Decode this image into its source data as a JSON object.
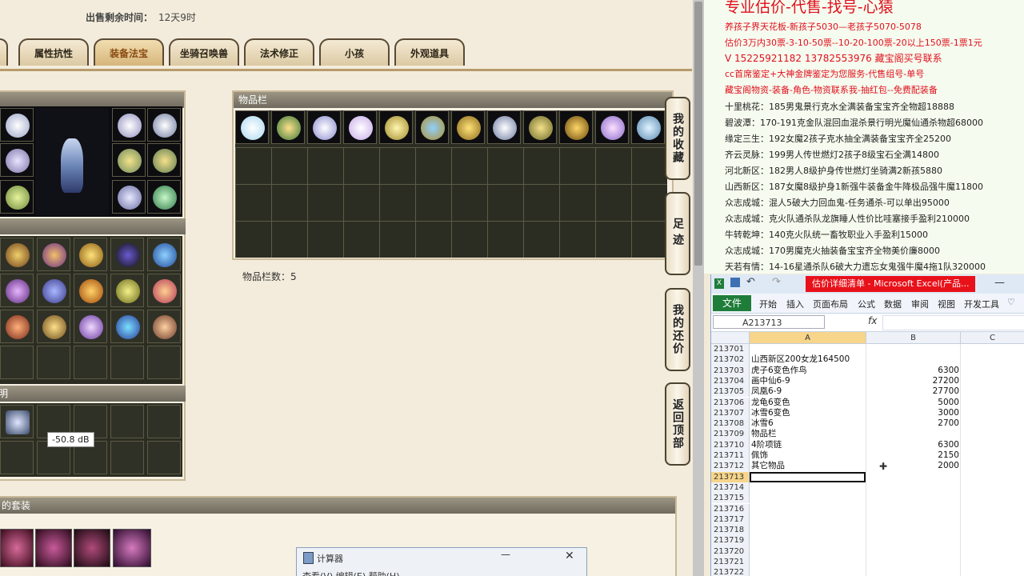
{
  "game": {
    "sell_label": "出售剩余时间：",
    "sell_value": "12天9时",
    "tabs": [
      {
        "label": "属性抗性",
        "active": false
      },
      {
        "label": "装备法宝",
        "active": true
      },
      {
        "label": "坐骑召唤兽",
        "active": false
      },
      {
        "label": "法术修正",
        "active": false
      },
      {
        "label": "小孩",
        "active": false
      },
      {
        "label": "外观道具",
        "active": false
      }
    ],
    "inventory_title": "物品栏",
    "inventory_count_label": "物品栏数：5",
    "partial_title_1": "明",
    "partial_title_2": "的套装",
    "side_buttons": [
      {
        "label": "我的收藏"
      },
      {
        "label": "足迹"
      },
      {
        "label": "我的还价"
      },
      {
        "label": "返回顶部"
      }
    ],
    "tooltip": "-50.8 dB"
  },
  "calculator": {
    "title": "计算器",
    "menu": "查看(V)  编辑(E)  帮助(H)"
  },
  "textdoc": {
    "lines": [
      {
        "text": "专业估价-代售-找号-心猿",
        "style": "big"
      },
      {
        "text": "养孩子界天花板-新孩子5030—老孩子5070-5078",
        "style": "red"
      },
      {
        "text": "估价3万内30票-3-10-50票--10-20-100票-20以上150票-1票1元",
        "style": "red"
      },
      {
        "text": "V 15225921182    13782553976    藏宝阁买号联系",
        "style": "red"
      },
      {
        "text": "cc首席鉴定+大神金牌鉴定为您服务-代售组号-单号",
        "style": "red"
      },
      {
        "text": "藏宝阁物资-装备-角色-物资联系我-抽红包--免费配装备",
        "style": "red"
      },
      {
        "text": "十里桃花：185男鬼景行克水全满装备宝宝齐全物超18888",
        "style": "normal"
      },
      {
        "text": "碧波潭：170-191克金队混回血混杀景行明光魔仙通杀物超68000",
        "style": "normal"
      },
      {
        "text": "缘定三生：192女魔2孩子克水抽全满装备宝宝齐全25200",
        "style": "normal"
      },
      {
        "text": "齐云灵脉：199男人传世燃灯2孩子8级宝石全满14800",
        "style": "normal"
      },
      {
        "text": "河北新区：182男人8级护身传世燃灯坐骑满2新孩5880",
        "style": "normal"
      },
      {
        "text": "山西新区：187女魔8级护身1新强牛装备金牛降极品强牛魔11800",
        "style": "normal"
      },
      {
        "text": "众志成城：混人5破大力回血鬼-任务通杀-可以单出95000",
        "style": "normal"
      },
      {
        "text": "众志成城：克火队通杀队龙旗睡人性价比哇塞接手盈利210000",
        "style": "normal"
      },
      {
        "text": "牛转乾坤：140克火队统一畜牧职业入手盈利15000",
        "style": "normal"
      },
      {
        "text": "众志成城：170男魔克火抽装备宝宝齐全物美价廉8000",
        "style": "normal"
      },
      {
        "text": "天若有情：14-16星通杀队6破大力遗忘女鬼强牛魔4拖1队320000",
        "style": "normal"
      }
    ]
  },
  "excel": {
    "title": "估价详细清单 - Microsoft Excel(产品...",
    "file_tab": "文件",
    "menus": [
      "开始",
      "插入",
      "页面布局",
      "公式",
      "数据",
      "审阅",
      "视图",
      "开发工具"
    ],
    "namebox": "A213713",
    "fx": "fx",
    "columns": [
      "A",
      "B",
      "C"
    ],
    "rows": [
      {
        "num": "213701",
        "a": "",
        "b": ""
      },
      {
        "num": "213702",
        "a": "山西新区200女龙164500",
        "b": ""
      },
      {
        "num": "213703",
        "a": "虎子6变色作鸟",
        "b": "6300"
      },
      {
        "num": "213704",
        "a": "画中仙6-9",
        "b": "27200"
      },
      {
        "num": "213705",
        "a": "凤凰6-9",
        "b": "27700"
      },
      {
        "num": "213706",
        "a": "龙龟6变色",
        "b": "5000"
      },
      {
        "num": "213707",
        "a": "冰雪6变色",
        "b": "3000"
      },
      {
        "num": "213708",
        "a": "冰雪6",
        "b": "2700"
      },
      {
        "num": "213709",
        "a": "物品栏",
        "b": ""
      },
      {
        "num": "213710",
        "a": "4阶项链",
        "b": "6300"
      },
      {
        "num": "213711",
        "a": "佩饰",
        "b": "2150"
      },
      {
        "num": "213712",
        "a": "其它物品",
        "b": "2000"
      },
      {
        "num": "213713",
        "a": "",
        "b": ""
      },
      {
        "num": "213714",
        "a": "",
        "b": ""
      },
      {
        "num": "213715",
        "a": "",
        "b": ""
      },
      {
        "num": "213716",
        "a": "",
        "b": ""
      },
      {
        "num": "213717",
        "a": "",
        "b": ""
      },
      {
        "num": "213718",
        "a": "",
        "b": ""
      },
      {
        "num": "213719",
        "a": "",
        "b": ""
      },
      {
        "num": "213720",
        "a": "",
        "b": ""
      },
      {
        "num": "213721",
        "a": "",
        "b": ""
      },
      {
        "num": "213722",
        "a": "",
        "b": ""
      }
    ],
    "selected_row": "213713"
  }
}
